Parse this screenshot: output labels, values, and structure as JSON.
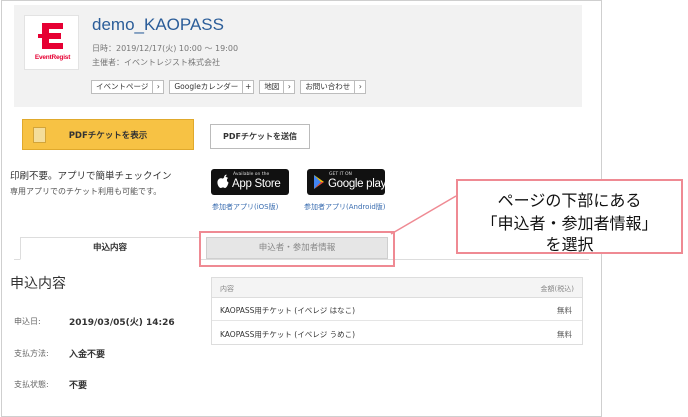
{
  "event": {
    "title": "demo_KAOPASS",
    "datetime": "日時：2019/12/17(火) 10:00 〜 19:00",
    "organizer": "主催者：イベントレジスト株式会社",
    "logo_text": "EventRegist",
    "links": [
      {
        "label": "イベントページ",
        "arrow": "›"
      },
      {
        "label": "Googleカレンダー",
        "arrow": "+"
      },
      {
        "label": "地図",
        "arrow": "›"
      },
      {
        "label": "お問い合わせ",
        "arrow": "›"
      }
    ]
  },
  "pdf": {
    "show_label": "PDFチケットを表示",
    "send_label": "PDFチケットを送信"
  },
  "checkin": {
    "line1": "印刷不要。アプリで簡単チェックイン",
    "line2": "専用アプリでのチケット利用も可能です。"
  },
  "apps": {
    "ios": {
      "small": "Available on the",
      "big": "App Store",
      "caption": "参加者アプリ(iOS版)"
    },
    "android": {
      "small": "GET IT ON",
      "big": "Google play",
      "caption": "参加者アプリ(Android版)"
    }
  },
  "tabs": {
    "active": "申込内容",
    "inactive": "申込者・参加者情報"
  },
  "application": {
    "heading": "申込内容",
    "rows": [
      {
        "label": "申込日:",
        "value": "2019/03/05(火) 14:26"
      },
      {
        "label": "支払方法:",
        "value": "入金不要"
      },
      {
        "label": "支払状態:",
        "value": "不要"
      }
    ]
  },
  "tickets": {
    "header_content": "内容",
    "header_amount": "金額(税込)",
    "rows": [
      {
        "name": "KAOPASS用チケット (イベレジ はなこ)",
        "price": "無料"
      },
      {
        "name": "KAOPASS用チケット (イベレジ うめこ)",
        "price": "無料"
      }
    ]
  },
  "callout": {
    "line1": "ページの下部にある",
    "line2": "「申込者・参加者情報」",
    "line3": "を選択"
  },
  "colors": {
    "accent_yellow": "#f7c244",
    "brand_red": "#e60033",
    "link_blue": "#2b5d99",
    "highlight_pink": "#ef8a93"
  }
}
